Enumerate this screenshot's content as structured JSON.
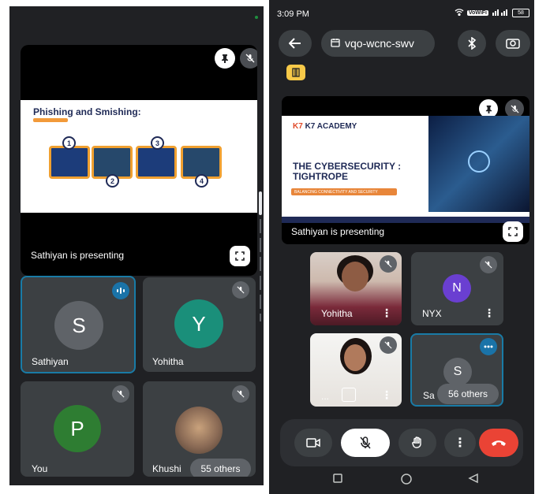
{
  "left": {
    "slide_title": "Phishing and Smishing:",
    "steps": [
      "1",
      "2",
      "3",
      "4"
    ],
    "presenting_label": "Sathiyan is presenting",
    "tiles": [
      {
        "initial": "S",
        "name": "Sathiyan",
        "color": "#5f6368"
      },
      {
        "initial": "Y",
        "name": "Yohitha",
        "color": "#1a8f7a"
      },
      {
        "initial": "P",
        "name": "You",
        "color": "#2e7d32"
      },
      {
        "initial": "",
        "name": "Khushi",
        "color": "#8a6a55"
      }
    ],
    "others_label": "55 others"
  },
  "right": {
    "status_time": "3:09 PM",
    "status_volte": "VoWiFi",
    "battery": "58",
    "meeting_code": "vqo-wcnc-swv",
    "slide_brand": "K7 ACADEMY",
    "slide_brand_mark": "K7",
    "slide_title": "THE CYBERSECURITY : TIGHTROPE",
    "slide_subtitle": "BALANCING CONNECTIVITY AND SECURITY",
    "presenting_label": "Sathiyan is presenting",
    "tiles": [
      {
        "name": "Yohitha"
      },
      {
        "initial": "N",
        "name": "NYX",
        "color": "#6a3fd1"
      },
      {
        "name": "..."
      },
      {
        "initial": "S",
        "name": "Sa",
        "color": "#5f6368"
      }
    ],
    "others_label": "56 others"
  },
  "colors": {
    "end_call": "#ea4335",
    "accent_blue": "#197ba6",
    "host_badge": "#f7c948"
  }
}
